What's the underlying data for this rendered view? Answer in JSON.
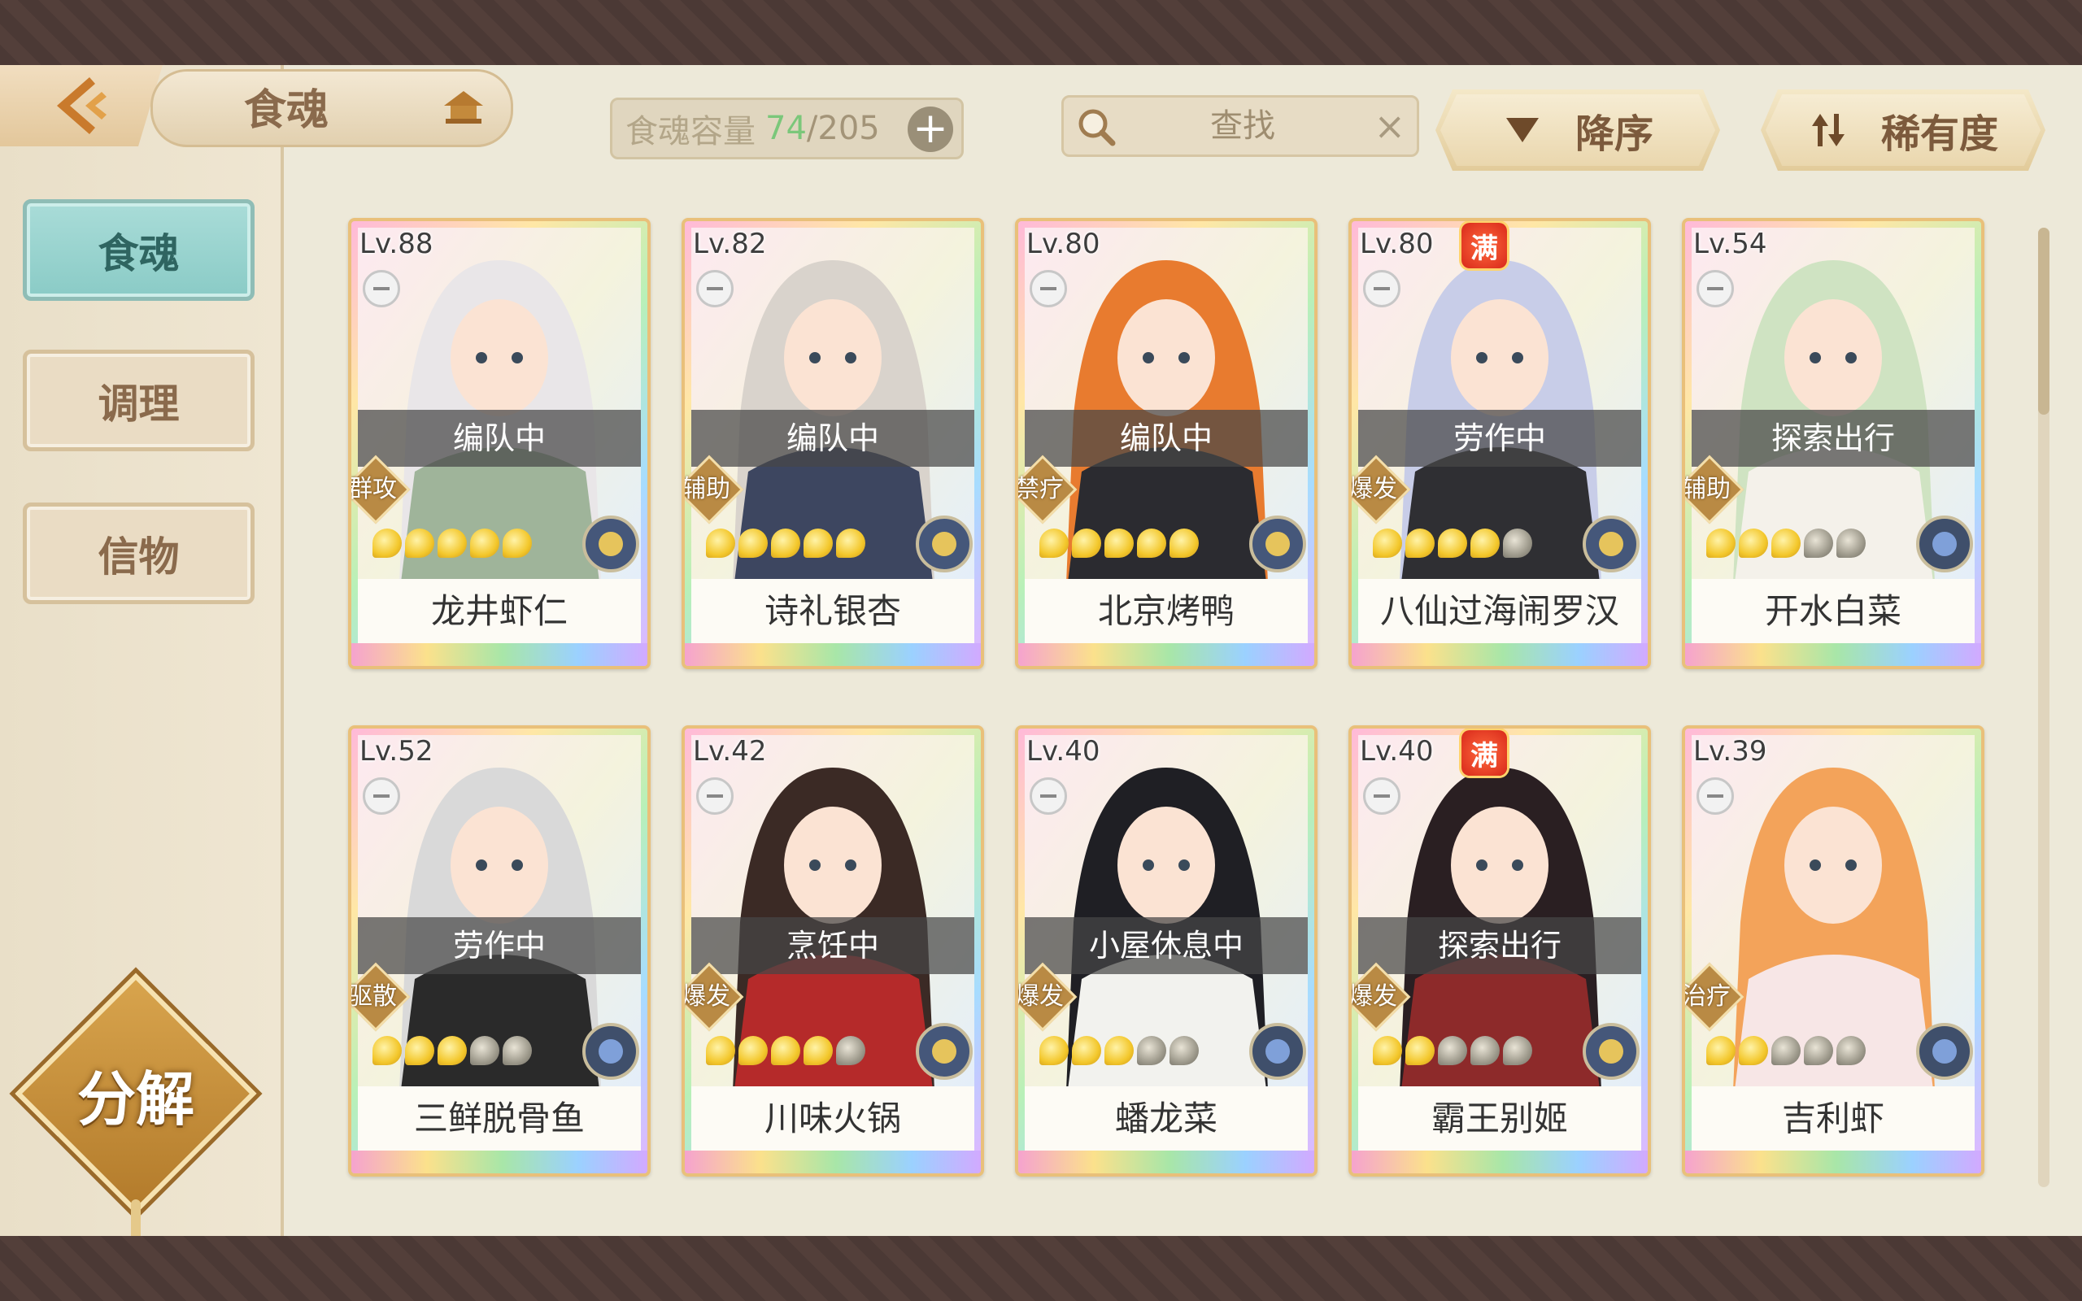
{
  "header": {
    "title": "食魂",
    "capacity_label": "食魂容量",
    "capacity_current": "74",
    "capacity_max": "/205",
    "capacity_add": "+",
    "search_placeholder": "查找",
    "search_clear": "×",
    "sort_order_label": "降序",
    "sort_field_label": "稀有度"
  },
  "sidebar": {
    "tabs": [
      {
        "label": "食魂",
        "active": true
      },
      {
        "label": "调理",
        "active": false
      },
      {
        "label": "信物",
        "active": false
      }
    ],
    "decompose_label": "分解"
  },
  "cards": [
    {
      "level": "Lv.88",
      "status": "编队中",
      "role": "群攻",
      "name": "龙井虾仁",
      "stars": 5,
      "stars_total": 5,
      "full": false,
      "element": "gold-flower-icon"
    },
    {
      "level": "Lv.82",
      "status": "编队中",
      "role": "辅助",
      "name": "诗礼银杏",
      "stars": 5,
      "stars_total": 5,
      "full": false,
      "element": "gold-flower-icon"
    },
    {
      "level": "Lv.80",
      "status": "编队中",
      "role": "禁疗",
      "name": "北京烤鸭",
      "stars": 5,
      "stars_total": 5,
      "full": false,
      "element": "gold-flower-icon"
    },
    {
      "level": "Lv.80",
      "status": "劳作中",
      "role": "爆发",
      "name": "八仙过海闹罗汉",
      "stars": 4,
      "stars_total": 5,
      "full": true,
      "full_label": "满",
      "element": "gold-flower-icon"
    },
    {
      "level": "Lv.54",
      "status": "探索出行",
      "role": "辅助",
      "name": "开水白菜",
      "stars": 3,
      "stars_total": 5,
      "full": false,
      "element": "blue-flower-icon"
    },
    {
      "level": "Lv.52",
      "status": "劳作中",
      "role": "驱散",
      "name": "三鲜脱骨鱼",
      "stars": 3,
      "stars_total": 5,
      "full": false,
      "element": "blue-flower-icon"
    },
    {
      "level": "Lv.42",
      "status": "烹饪中",
      "role": "爆发",
      "name": "川味火锅",
      "stars": 4,
      "stars_total": 5,
      "full": false,
      "element": "gold-flower-icon"
    },
    {
      "level": "Lv.40",
      "status": "小屋休息中",
      "role": "爆发",
      "name": "蟠龙菜",
      "stars": 3,
      "stars_total": 5,
      "full": false,
      "element": "blue-flower-icon"
    },
    {
      "level": "Lv.40",
      "status": "探索出行",
      "role": "爆发",
      "name": "霸王别姬",
      "stars": 2,
      "stars_total": 5,
      "full": true,
      "full_label": "满",
      "element": "gold-flower-icon"
    },
    {
      "level": "Lv.39",
      "status": "",
      "role": "治疗",
      "name": "吉利虾",
      "stars": 2,
      "stars_total": 5,
      "full": false,
      "element": "blue-flower-icon"
    }
  ],
  "colors": {
    "accent_teal": "#8acbc6",
    "gold": "#e2cb9a",
    "capacity_current": "#7bc77a",
    "background": "#ede9d9"
  }
}
